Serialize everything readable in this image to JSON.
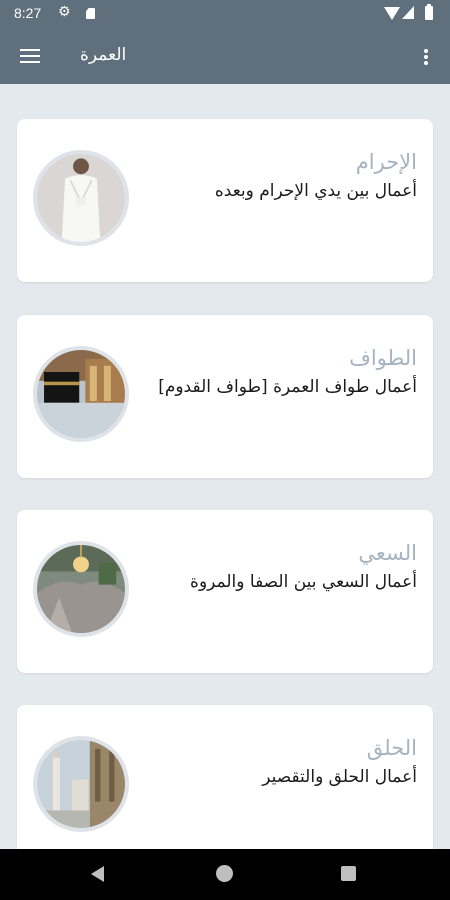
{
  "status_bar": {
    "time": "8:27"
  },
  "app_bar": {
    "title": "العمرة"
  },
  "cards": [
    {
      "title": "الإحرام",
      "description": "أعمال بين يدي الإحرام وبعده"
    },
    {
      "title": "الطواف",
      "description": "أعمال طواف العمرة [طواف القدوم]"
    },
    {
      "title": "السعي",
      "description": "أعمال السعي بين الصفا والمروة"
    },
    {
      "title": "الحلق",
      "description": "أعمال الحلق والتقصير"
    }
  ],
  "icons": {
    "status": [
      "gear-icon",
      "sd-card-icon",
      "wifi-icon",
      "signal-icon",
      "battery-icon"
    ],
    "app_bar": [
      "menu-icon",
      "more-vert-icon"
    ],
    "nav": [
      "back-icon",
      "home-icon",
      "recents-icon"
    ]
  },
  "colors": {
    "app_bar": "#5f6f7b",
    "background": "#e4e9ee",
    "card_title": "#a5b4c0",
    "card_text": "#1b1b1b"
  }
}
